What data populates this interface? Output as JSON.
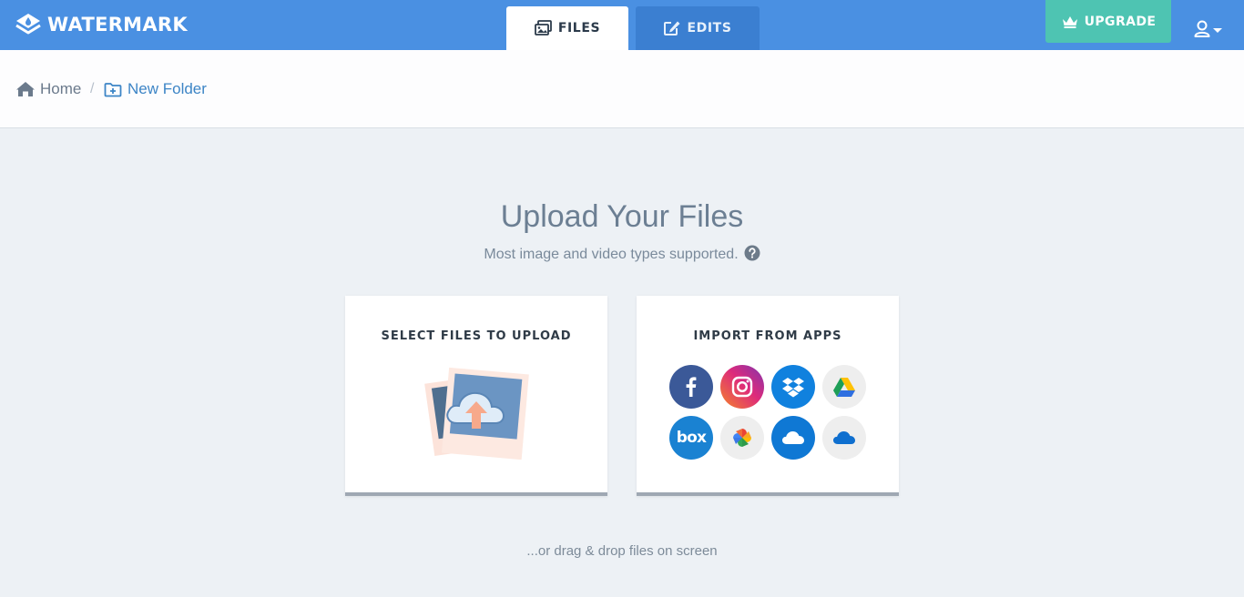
{
  "brand": {
    "name": "WATERMARK"
  },
  "tabs": [
    {
      "label": "FILES",
      "icon": "images-icon",
      "active": true
    },
    {
      "label": "EDITS",
      "icon": "edit-icon",
      "active": false
    }
  ],
  "upgrade": {
    "label": "UPGRADE",
    "icon": "crown-icon"
  },
  "user_menu": {
    "icon": "user-icon"
  },
  "breadcrumb": {
    "home": "Home",
    "separator": "/",
    "folder": "New Folder"
  },
  "main": {
    "title": "Upload Your Files",
    "subtitle": "Most image and video types supported."
  },
  "cards": {
    "select": {
      "title": "SELECT FILES TO UPLOAD"
    },
    "import": {
      "title": "IMPORT FROM APPS",
      "apps": [
        {
          "name": "Facebook",
          "icon": "facebook-icon",
          "color": "#3b5998"
        },
        {
          "name": "Instagram",
          "icon": "instagram-icon",
          "color": "#e1306c"
        },
        {
          "name": "Dropbox",
          "icon": "dropbox-icon",
          "color": "#1081de"
        },
        {
          "name": "Google Drive",
          "icon": "google-drive-icon",
          "color": "#eeeeee"
        },
        {
          "name": "Box",
          "icon": "box-icon",
          "color": "#1a82d2",
          "text": "box"
        },
        {
          "name": "Google Photos",
          "icon": "google-photos-icon",
          "color": "#eeeeee"
        },
        {
          "name": "OneDrive",
          "icon": "onedrive-icon",
          "color": "#0f78d4"
        },
        {
          "name": "OneDrive Business",
          "icon": "onedrive-business-icon",
          "color": "#eeeeee"
        }
      ]
    }
  },
  "footer": {
    "dragdrop": "...or drag & drop files on screen"
  },
  "colors": {
    "topbar": "#4a90e2",
    "upgrade": "#4ec4b2",
    "background": "#edf1f5",
    "link": "#3d85c6"
  }
}
